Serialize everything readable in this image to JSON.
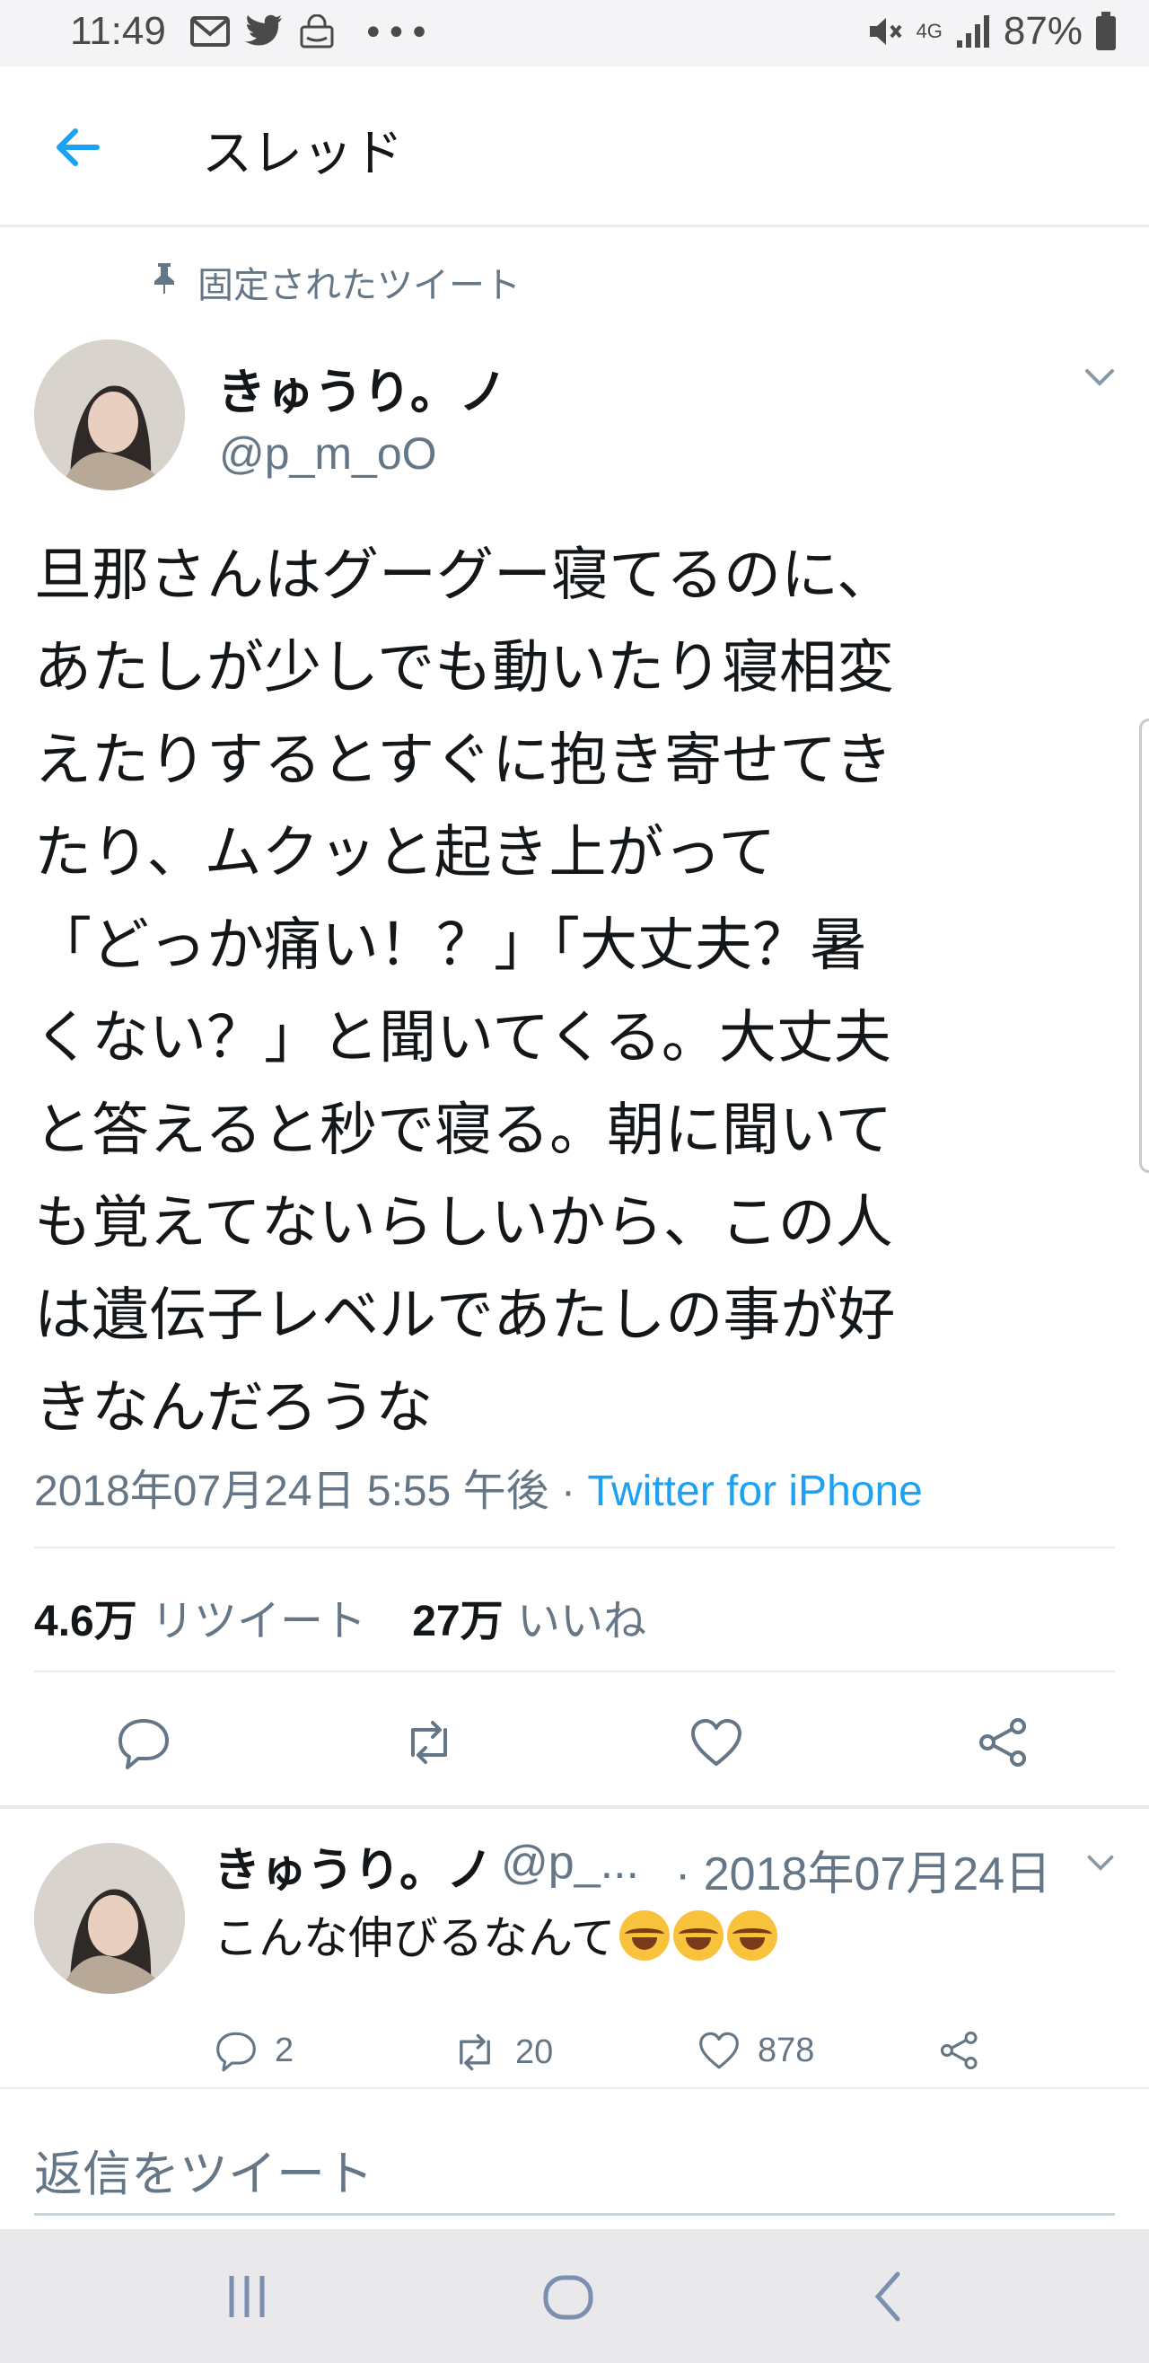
{
  "status_bar": {
    "time": "11:49",
    "network": "4G",
    "battery": "87%"
  },
  "header": {
    "title": "スレッド"
  },
  "pinned_label": "固定されたツイート",
  "tweet": {
    "name": "きゅうり。ノ",
    "handle": "@p_m_oO",
    "text": "旦那さんはグーグー寝てるのに、\nあたしが少しでも動いたり寝相変\nえたりするとすぐに抱き寄せてき\nたり、ムクッと起き上がって\n「どっか痛い！？」「大丈夫？暑\nくない？」と聞いてくる。大丈夫\nと答えると秒で寝る。朝に聞いて\nも覚えてないらしいから、この人\nは遺伝子レベルであたしの事が好\nきなんだろうな",
    "timestamp": "2018年07月24日 5:55 午後",
    "separator": "·",
    "source": "Twitter for iPhone",
    "retweets_count": "4.6万",
    "retweets_label": "リツイート",
    "likes_count": "27万",
    "likes_label": "いいね"
  },
  "reply": {
    "name": "きゅうり。ノ",
    "handle": "@p_...",
    "date": "· 2018年07月24日",
    "text": "こんな伸びるなんて",
    "emoji_count": 3,
    "reply_count": "2",
    "retweet_count": "20",
    "like_count": "878"
  },
  "compose": {
    "placeholder": "返信をツイート"
  },
  "colors": {
    "accent": "#1da1f2",
    "secondary_text": "#657786",
    "divider": "#e6ecf0",
    "icon": "#657786"
  }
}
